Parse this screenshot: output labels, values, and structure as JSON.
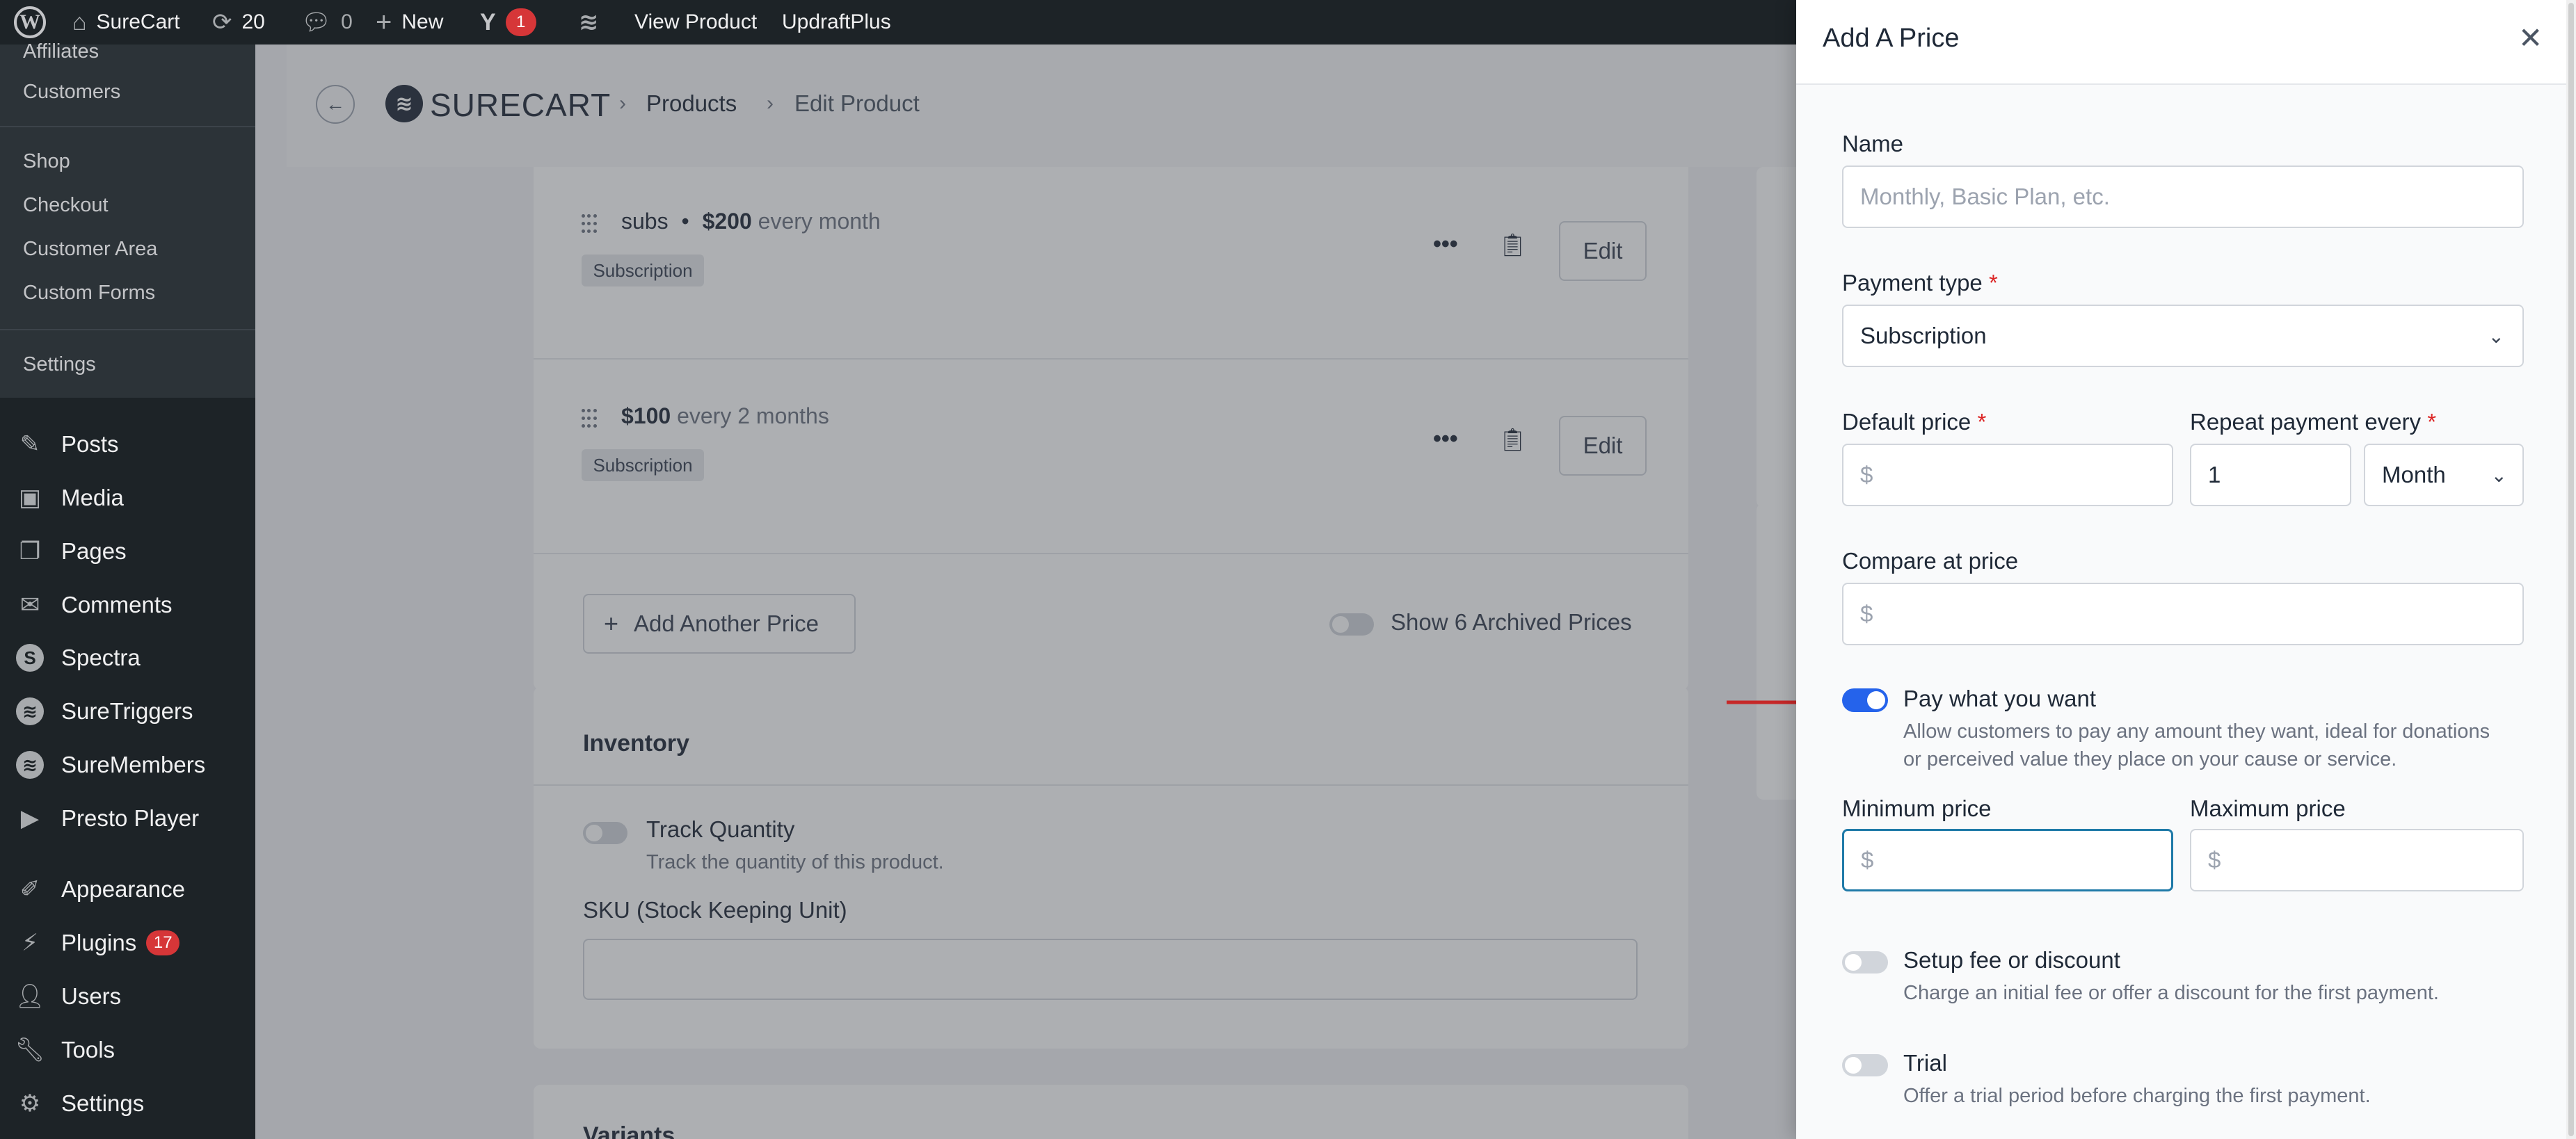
{
  "adminbar": {
    "site_name": "SureCart",
    "updates_count": "20",
    "comments_count": "0",
    "new_label": "New",
    "yoast_badge": "1",
    "view_product": "View Product",
    "updraft": "UpdraftPlus"
  },
  "sidebar": {
    "submenu": [
      "Affiliates",
      "Customers",
      "Shop",
      "Checkout",
      "Customer Area",
      "Custom Forms",
      "Settings"
    ],
    "menu": [
      {
        "label": "Posts",
        "icon": "pin-icon"
      },
      {
        "label": "Media",
        "icon": "media-icon"
      },
      {
        "label": "Pages",
        "icon": "pages-icon"
      },
      {
        "label": "Comments",
        "icon": "comments-icon"
      },
      {
        "label": "Spectra",
        "icon": "spectra-icon"
      },
      {
        "label": "SureTriggers",
        "icon": "suretriggers-icon"
      },
      {
        "label": "SureMembers",
        "icon": "suremembers-icon"
      },
      {
        "label": "Presto Player",
        "icon": "play-icon"
      },
      {
        "label": "Appearance",
        "icon": "brush-icon"
      },
      {
        "label": "Plugins",
        "icon": "plug-icon",
        "badge": "17"
      },
      {
        "label": "Users",
        "icon": "user-icon"
      },
      {
        "label": "Tools",
        "icon": "wrench-icon"
      },
      {
        "label": "Settings",
        "icon": "settings-icon"
      }
    ]
  },
  "header": {
    "brand": "SURECART",
    "breadcrumb_products": "Products",
    "breadcrumb_edit": "Edit Product"
  },
  "prices": [
    {
      "name": "subs",
      "amount": "$200",
      "interval": "every month",
      "tag": "Subscription",
      "edit": "Edit"
    },
    {
      "amount": "$100",
      "interval": "every 2 months",
      "tag": "Subscription",
      "edit": "Edit"
    }
  ],
  "add_another_price": "Add Another Price",
  "show_archived": "Show 6 Archived Prices",
  "inventory": {
    "title": "Inventory",
    "track_label": "Track Quantity",
    "track_desc": "Track the quantity of this product.",
    "sku_label": "SKU (Stock Keeping Unit)"
  },
  "variants_title": "Variants",
  "drawer": {
    "title": "Add A Price",
    "name_label": "Name",
    "name_placeholder": "Monthly, Basic Plan, etc.",
    "payment_type_label": "Payment type",
    "payment_type_value": "Subscription",
    "default_price_label": "Default price",
    "currency_symbol": "$",
    "repeat_label": "Repeat payment every",
    "repeat_value": "1",
    "repeat_unit": "Month",
    "compare_label": "Compare at price",
    "pwyw_label": "Pay what you want",
    "pwyw_desc_1": "Allow customers to pay any amount they want, ideal for donations",
    "pwyw_desc_2": "or perceived value they place on your cause or service.",
    "min_label": "Minimum price",
    "max_label": "Maximum price",
    "setup_label": "Setup fee or discount",
    "setup_desc": "Charge an initial fee or offer a discount for the first payment.",
    "trial_label": "Trial",
    "trial_desc": "Offer a trial period before charging the first payment.",
    "required_mark": "*"
  },
  "colors": {
    "accent": "#2563eb",
    "annotation_arrow": "#c62828",
    "admin_bar": "#1d2327",
    "badge": "#d63638"
  }
}
